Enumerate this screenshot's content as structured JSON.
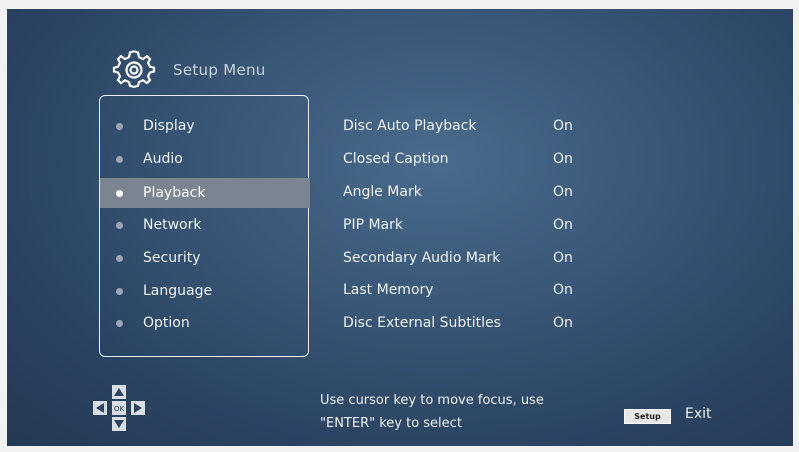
{
  "header": {
    "title": "Setup Menu",
    "icon": "gear-icon"
  },
  "menu": {
    "items": [
      {
        "label": "Display",
        "selected": false
      },
      {
        "label": "Audio",
        "selected": false
      },
      {
        "label": "Playback",
        "selected": true
      },
      {
        "label": "Network",
        "selected": false
      },
      {
        "label": "Security",
        "selected": false
      },
      {
        "label": "Language",
        "selected": false
      },
      {
        "label": "Option",
        "selected": false
      }
    ]
  },
  "settings": [
    {
      "label": "Disc Auto Playback",
      "value": "On"
    },
    {
      "label": "Closed Caption",
      "value": "On"
    },
    {
      "label": "Angle Mark",
      "value": "On"
    },
    {
      "label": "PIP Mark",
      "value": "On"
    },
    {
      "label": "Secondary Audio Mark",
      "value": "On"
    },
    {
      "label": "Last Memory",
      "value": "On"
    },
    {
      "label": "Disc External Subtitles",
      "value": "On"
    }
  ],
  "footer": {
    "help_line1": "Use cursor key to move focus, use",
    "help_line2": "\"ENTER\" key to select",
    "dpad_ok": "OK",
    "setup_key": "Setup",
    "exit_label": "Exit"
  },
  "colors": {
    "background": "#2f4b6b",
    "selected_row": "#7a8591",
    "text": "#eef2f6"
  }
}
